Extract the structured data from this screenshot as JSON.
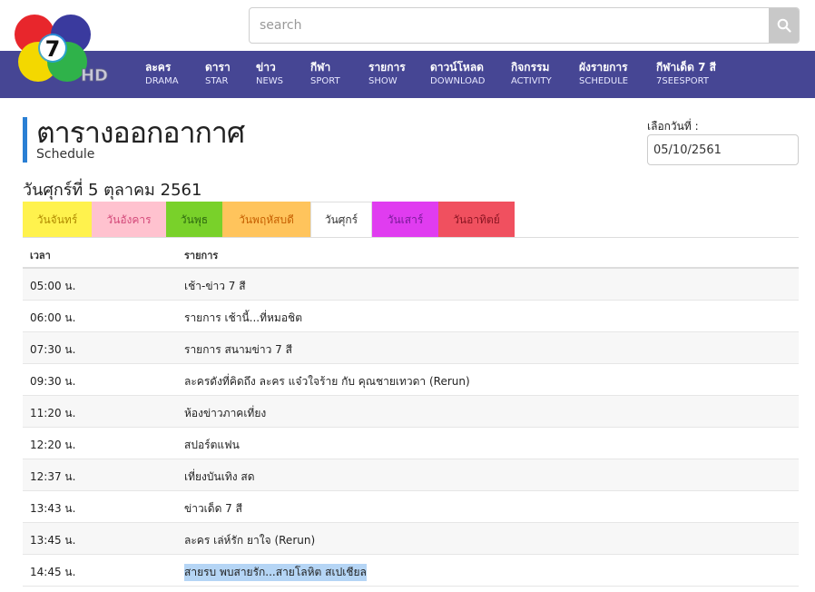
{
  "search": {
    "placeholder": "search"
  },
  "logo": {
    "channel_number": "7",
    "hd_label": "HD"
  },
  "nav": [
    {
      "th": "ละคร",
      "en": "DRAMA"
    },
    {
      "th": "ดารา",
      "en": "STAR"
    },
    {
      "th": "ข่าว",
      "en": "NEWS"
    },
    {
      "th": "กีฬา",
      "en": "SPORT"
    },
    {
      "th": "รายการ",
      "en": "SHOW"
    },
    {
      "th": "ดาวน์โหลด",
      "en": "DOWNLOAD"
    },
    {
      "th": "กิจกรรม",
      "en": "ACTIVITY"
    },
    {
      "th": "ผังรายการ",
      "en": "SCHEDULE"
    },
    {
      "th": "กีฬาเด็ด 7 สี",
      "en": "7SEESPORT"
    }
  ],
  "page": {
    "title": "ตารางออกอากาศ",
    "subtitle": "Schedule",
    "date_label": "เลือกวันที่ :",
    "date_value": "05/10/2561",
    "day_heading": "วันศุกร์ที่ 5 ตุลาคม 2561"
  },
  "tabs": [
    {
      "label": "วันจันทร์",
      "bg": "#fff24d",
      "fg": "#b08a00"
    },
    {
      "label": "วันอังคาร",
      "bg": "#ffc2cf",
      "fg": "#d44a7a"
    },
    {
      "label": "วันพุธ",
      "bg": "#79d12a",
      "fg": "#2f6a10"
    },
    {
      "label": "วันพฤหัสบดี",
      "bg": "#ffc45c",
      "fg": "#c65f00"
    },
    {
      "label": "วันศุกร์",
      "bg": "#ffffff",
      "fg": "#333333"
    },
    {
      "label": "วันเสาร์",
      "bg": "#e03cf0",
      "fg": "#7a1a9a"
    },
    {
      "label": "วันอาทิตย์",
      "bg": "#f0505f",
      "fg": "#8a1522"
    }
  ],
  "table": {
    "headers": {
      "time": "เวลา",
      "program": "รายการ"
    },
    "rows": [
      {
        "time": "05:00 น.",
        "program": "เช้า-ข่าว 7 สี"
      },
      {
        "time": "06:00 น.",
        "program": "รายการ เช้านี้...ที่หมอชิต"
      },
      {
        "time": "07:30 น.",
        "program": "รายการ สนามข่าว 7 สี"
      },
      {
        "time": "09:30 น.",
        "program": "ละครดังที่คิดถึง ละคร แจ๋วใจร้าย กับ คุณชายเทวดา (Rerun)"
      },
      {
        "time": "11:20 น.",
        "program": "ห้องข่าวภาคเที่ยง"
      },
      {
        "time": "12:20 น.",
        "program": "สปอร์ตแฟน"
      },
      {
        "time": "12:37 น.",
        "program": "เที่ยงบันเทิง สด"
      },
      {
        "time": "13:43 น.",
        "program": "ข่าวเด็ด 7 สี"
      },
      {
        "time": "13:45 น.",
        "program": "ละคร เล่ห์รัก ยาใจ (Rerun)"
      },
      {
        "time": "14:45 น.",
        "program": "สายรบ พบสายรัก...สายโลหิต สเปเชียล"
      }
    ]
  }
}
